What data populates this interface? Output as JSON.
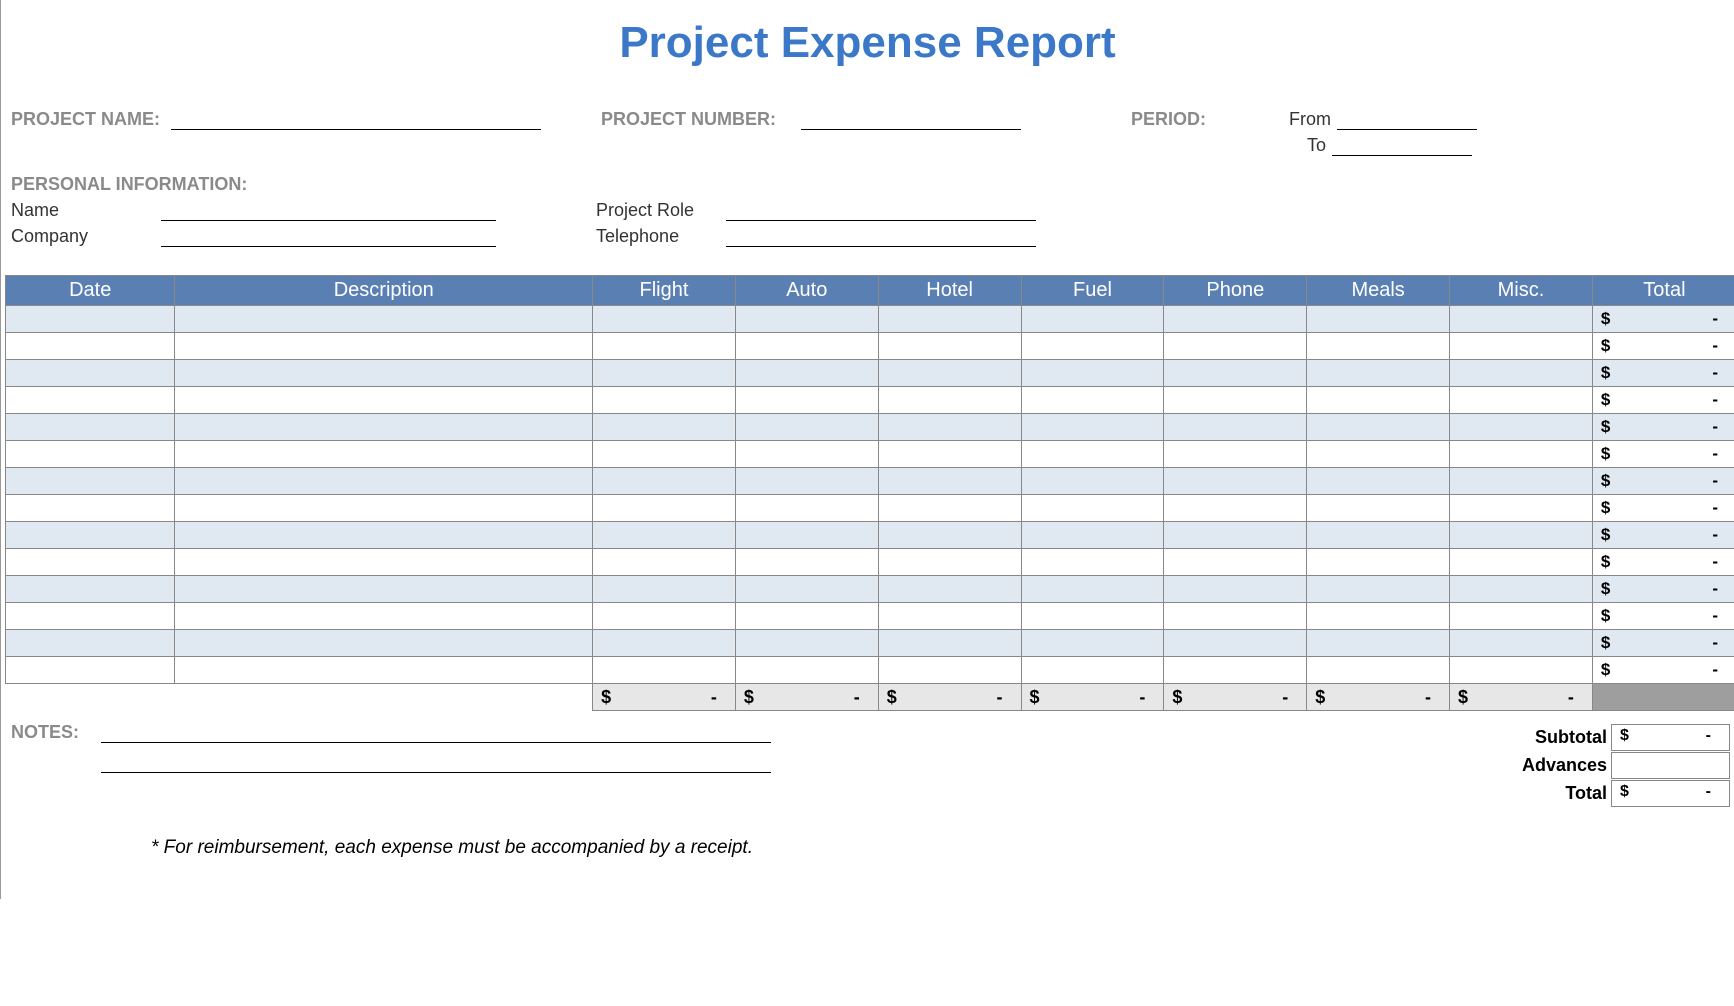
{
  "title": "Project Expense Report",
  "fields": {
    "project_name_label": "PROJECT NAME:",
    "project_number_label": "PROJECT NUMBER:",
    "period_label": "PERIOD:",
    "period_from_label": "From",
    "period_to_label": "To",
    "personal_info_label": "PERSONAL INFORMATION:",
    "name_label": "Name",
    "company_label": "Company",
    "project_role_label": "Project Role",
    "telephone_label": "Telephone",
    "notes_label": "NOTES:"
  },
  "table": {
    "headers": [
      "Date",
      "Description",
      "Flight",
      "Auto",
      "Hotel",
      "Fuel",
      "Phone",
      "Meals",
      "Misc.",
      "Total"
    ],
    "row_count": 14,
    "currency": "$",
    "dash": "-",
    "colsum_cols": 7
  },
  "summary": {
    "subtotal_label": "Subtotal",
    "advances_label": "Advances",
    "total_label": "Total",
    "currency": "$",
    "dash": "-"
  },
  "footnote": "* For reimbursement, each expense must be accompanied by a receipt."
}
